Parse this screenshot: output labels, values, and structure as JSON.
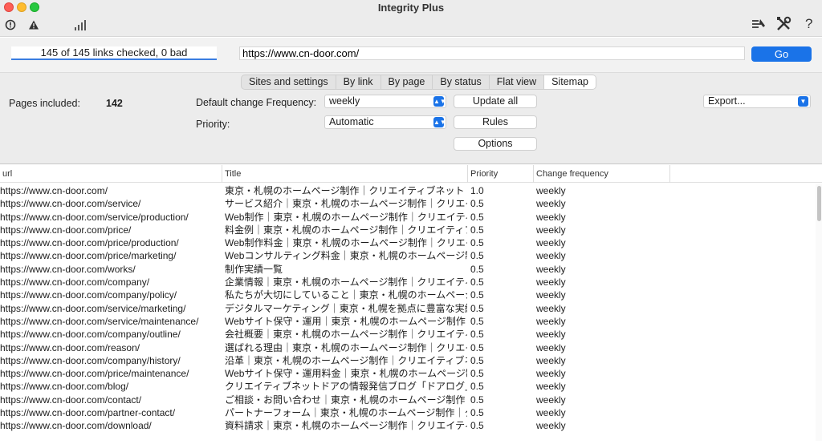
{
  "window": {
    "title": "Integrity Plus"
  },
  "toolbar": {
    "right_icons": [
      "tools-icon",
      "wrench-screwdriver-icon",
      "help-icon"
    ],
    "help_label": "?"
  },
  "address": {
    "status": "145 of 145 links checked, 0 bad",
    "url": "https://www.cn-door.com/",
    "go_label": "Go"
  },
  "tabs": [
    {
      "label": "Sites and settings"
    },
    {
      "label": "By link"
    },
    {
      "label": "By page"
    },
    {
      "label": "By status"
    },
    {
      "label": "Flat view"
    },
    {
      "label": "Sitemap",
      "active": true
    }
  ],
  "sitemap": {
    "pages_included_label": "Pages included:",
    "pages_included_value": "142",
    "change_freq_label": "Default change Frequency:",
    "change_freq_value": "weekly",
    "priority_label": "Priority:",
    "priority_value": "Automatic",
    "update_all_label": "Update all",
    "rules_label": "Rules",
    "options_label": "Options",
    "export_value": "Export..."
  },
  "table": {
    "columns": [
      "url",
      "Title",
      "Priority",
      "Change frequency"
    ],
    "rows": [
      {
        "url": "https://www.cn-door.com/",
        "title": "東京・札幌のホームページ制作｜クリエイティブネットドア",
        "priority": "1.0",
        "freq": "weekly"
      },
      {
        "url": "https://www.cn-door.com/service/",
        "title": "サービス紹介｜東京・札幌のホームページ制作｜クリエイティブネットドア",
        "priority": "0.5",
        "freq": "weekly"
      },
      {
        "url": "https://www.cn-door.com/service/production/",
        "title": "Web制作｜東京・札幌のホームページ制作｜クリエイティブネットドア",
        "priority": "0.5",
        "freq": "weekly"
      },
      {
        "url": "https://www.cn-door.com/price/",
        "title": "料金例｜東京・札幌のホームページ制作｜クリエイティブネットドア",
        "priority": "0.5",
        "freq": "weekly"
      },
      {
        "url": "https://www.cn-door.com/price/production/",
        "title": "Web制作料金｜東京・札幌のホームページ制作｜クリエイティブネットドア",
        "priority": "0.5",
        "freq": "weekly"
      },
      {
        "url": "https://www.cn-door.com/price/marketing/",
        "title": "Webコンサルティング料金｜東京・札幌のホームページ制作・Web",
        "priority": "0.5",
        "freq": "weekly"
      },
      {
        "url": "https://www.cn-door.com/works/",
        "title": "制作実績一覧",
        "priority": "0.5",
        "freq": "weekly"
      },
      {
        "url": "https://www.cn-door.com/company/",
        "title": "企業情報｜東京・札幌のホームページ制作｜クリエイティブネットドア",
        "priority": "0.5",
        "freq": "weekly"
      },
      {
        "url": "https://www.cn-door.com/company/policy/",
        "title": "私たちが大切にしていること｜東京・札幌のホームページ制作｜ク",
        "priority": "0.5",
        "freq": "weekly"
      },
      {
        "url": "https://www.cn-door.com/service/marketing/",
        "title": "デジタルマーケティング｜東京・札幌を拠点に豊富な実績｜クリエ",
        "priority": "0.5",
        "freq": "weekly"
      },
      {
        "url": "https://www.cn-door.com/service/maintenance/",
        "title": "Webサイト保守・運用｜東京・札幌のホームページ制作｜クリエイ",
        "priority": "0.5",
        "freq": "weekly"
      },
      {
        "url": "https://www.cn-door.com/company/outline/",
        "title": "会社概要｜東京・札幌のホームページ制作｜クリエイティブネットドア",
        "priority": "0.5",
        "freq": "weekly"
      },
      {
        "url": "https://www.cn-door.com/reason/",
        "title": "選ばれる理由｜東京・札幌のホームページ制作｜クリエイティブネットドア",
        "priority": "0.5",
        "freq": "weekly"
      },
      {
        "url": "https://www.cn-door.com/company/history/",
        "title": "沿革｜東京・札幌のホームページ制作｜クリエイティブネットドア",
        "priority": "0.5",
        "freq": "weekly"
      },
      {
        "url": "https://www.cn-door.com/price/maintenance/",
        "title": "Webサイト保守・運用料金｜東京・札幌のホームページ制作｜クリ",
        "priority": "0.5",
        "freq": "weekly"
      },
      {
        "url": "https://www.cn-door.com/blog/",
        "title": "クリエイティブネットドアの情報発信ブログ「ドアログ」",
        "priority": "0.5",
        "freq": "weekly"
      },
      {
        "url": "https://www.cn-door.com/contact/",
        "title": "ご相談・お問い合わせ｜東京・札幌のホームページ制作｜クリエイ",
        "priority": "0.5",
        "freq": "weekly"
      },
      {
        "url": "https://www.cn-door.com/partner-contact/",
        "title": "パートナーフォーム｜東京・札幌のホームページ制作｜クリエイティブ",
        "priority": "0.5",
        "freq": "weekly"
      },
      {
        "url": "https://www.cn-door.com/download/",
        "title": "資料請求｜東京・札幌のホームページ制作｜クリエイティブネットドア",
        "priority": "0.5",
        "freq": "weekly"
      }
    ]
  }
}
